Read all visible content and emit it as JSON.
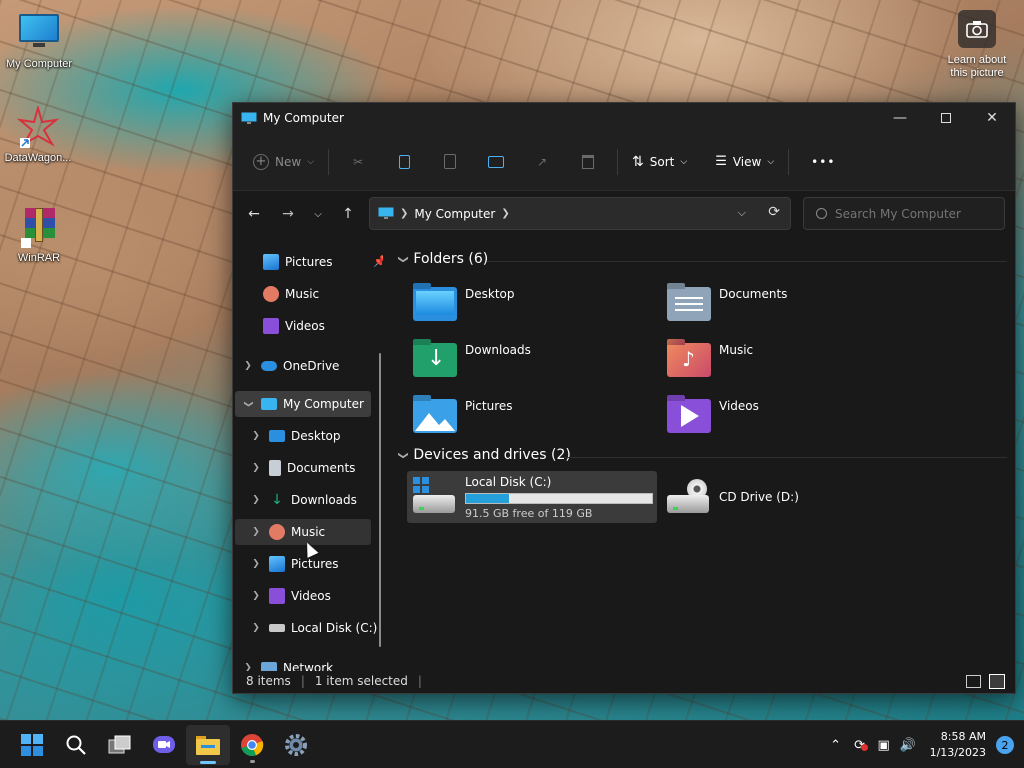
{
  "desktop": {
    "icons": [
      {
        "label": "My Computer"
      },
      {
        "label": "DataWagon..."
      },
      {
        "label": "WinRAR"
      }
    ],
    "learn_line1": "Learn about",
    "learn_line2": "this picture"
  },
  "window": {
    "title": "My Computer",
    "toolbar": {
      "new": "New",
      "sort": "Sort",
      "view": "View",
      "more": "•••"
    },
    "address": {
      "crumb": "My Computer"
    },
    "search": {
      "placeholder": "Search My Computer"
    },
    "sidebar": {
      "quick": [
        {
          "label": "Pictures"
        },
        {
          "label": "Music"
        },
        {
          "label": "Videos"
        }
      ],
      "onedrive": "OneDrive",
      "mycomputer": "My Computer",
      "children": [
        {
          "label": "Desktop"
        },
        {
          "label": "Documents"
        },
        {
          "label": "Downloads"
        },
        {
          "label": "Music"
        },
        {
          "label": "Pictures"
        },
        {
          "label": "Videos"
        },
        {
          "label": "Local Disk (C:)"
        }
      ],
      "network": "Network"
    },
    "folders": {
      "heading": "Folders (6)",
      "items": [
        {
          "label": "Desktop",
          "color": "#2b8fe0"
        },
        {
          "label": "Documents",
          "color": "#8fa4b8"
        },
        {
          "label": "Downloads",
          "color": "#22a06b"
        },
        {
          "label": "Music",
          "color": "#e2735a"
        },
        {
          "label": "Pictures",
          "color": "#3aa0e8"
        },
        {
          "label": "Videos",
          "color": "#8a4fd8"
        }
      ]
    },
    "drives": {
      "heading": "Devices and drives (2)",
      "items": [
        {
          "label": "Local Disk (C:)",
          "free": "91.5 GB free of 119 GB",
          "used_fraction": 0.23
        },
        {
          "label": "CD Drive (D:)"
        }
      ]
    },
    "status": {
      "items": "8 items",
      "selected": "1 item selected"
    }
  },
  "taskbar": {
    "time": "8:58 AM",
    "date": "1/13/2023",
    "notifications": "2"
  }
}
